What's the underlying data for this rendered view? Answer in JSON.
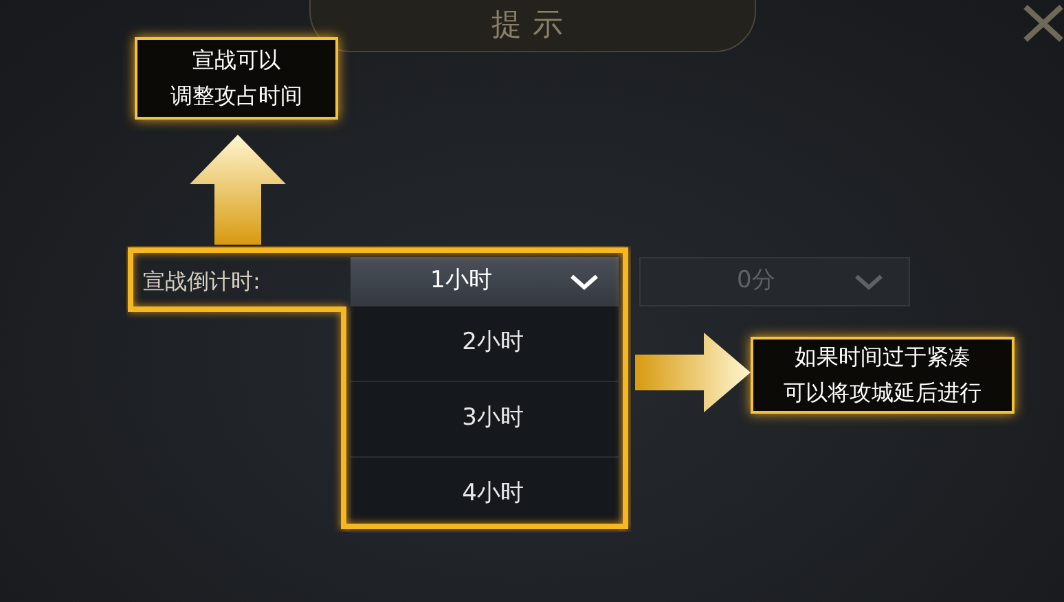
{
  "dialog": {
    "title": "提示"
  },
  "countdown": {
    "label": "宣战倒计时:",
    "hours": {
      "value": "1小时",
      "expanded": true,
      "options": [
        {
          "label": "2小时"
        },
        {
          "label": "3小时"
        },
        {
          "label": "4小时"
        }
      ]
    },
    "minutes": {
      "value": "0分",
      "disabled": true
    }
  },
  "callouts": [
    {
      "lines": [
        "宣战可以",
        "调整攻占时间"
      ],
      "kind": "up"
    },
    {
      "lines": [
        "如果时间过于紧凑",
        "可以将攻城延后进行"
      ],
      "kind": "right"
    }
  ]
}
